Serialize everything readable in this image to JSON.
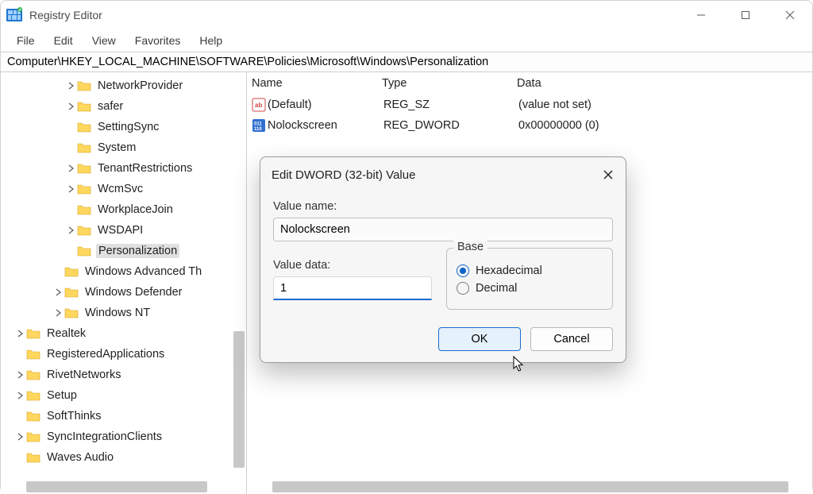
{
  "window": {
    "title": "Registry Editor"
  },
  "menu": {
    "file": "File",
    "edit": "Edit",
    "view": "View",
    "favorites": "Favorites",
    "help": "Help"
  },
  "address": {
    "path": "Computer\\HKEY_LOCAL_MACHINE\\SOFTWARE\\Policies\\Microsoft\\Windows\\Personalization"
  },
  "tree": [
    {
      "indent": 82,
      "exp": ">",
      "label": "NetworkProvider"
    },
    {
      "indent": 82,
      "exp": ">",
      "label": "safer"
    },
    {
      "indent": 82,
      "exp": "",
      "label": "SettingSync"
    },
    {
      "indent": 82,
      "exp": "",
      "label": "System"
    },
    {
      "indent": 82,
      "exp": ">",
      "label": "TenantRestrictions"
    },
    {
      "indent": 82,
      "exp": ">",
      "label": "WcmSvc"
    },
    {
      "indent": 82,
      "exp": "",
      "label": "WorkplaceJoin"
    },
    {
      "indent": 82,
      "exp": ">",
      "label": "WSDAPI"
    },
    {
      "indent": 82,
      "exp": "",
      "label": "Personalization",
      "selected": true
    },
    {
      "indent": 66,
      "exp": "",
      "label": "Windows Advanced Th"
    },
    {
      "indent": 66,
      "exp": ">",
      "label": "Windows Defender"
    },
    {
      "indent": 66,
      "exp": ">",
      "label": "Windows NT"
    },
    {
      "indent": 18,
      "exp": ">",
      "label": "Realtek"
    },
    {
      "indent": 18,
      "exp": "",
      "label": "RegisteredApplications"
    },
    {
      "indent": 18,
      "exp": ">",
      "label": "RivetNetworks"
    },
    {
      "indent": 18,
      "exp": ">",
      "label": "Setup"
    },
    {
      "indent": 18,
      "exp": "",
      "label": "SoftThinks"
    },
    {
      "indent": 18,
      "exp": ">",
      "label": "SyncIntegrationClients"
    },
    {
      "indent": 18,
      "exp": "",
      "label": "Waves Audio"
    }
  ],
  "columns": {
    "name": "Name",
    "type": "Type",
    "data": "Data"
  },
  "values": [
    {
      "icon": "sz",
      "name": "(Default)",
      "type": "REG_SZ",
      "data": "(value not set)"
    },
    {
      "icon": "dword",
      "name": "Nolockscreen",
      "type": "REG_DWORD",
      "data": "0x00000000 (0)"
    }
  ],
  "dialog": {
    "title": "Edit DWORD (32-bit) Value",
    "value_name_label": "Value name:",
    "value_name": "Nolockscreen",
    "value_data_label": "Value data:",
    "value_data": "1",
    "base_label": "Base",
    "hex_label": "Hexadecimal",
    "dec_label": "Decimal",
    "ok": "OK",
    "cancel": "Cancel"
  }
}
